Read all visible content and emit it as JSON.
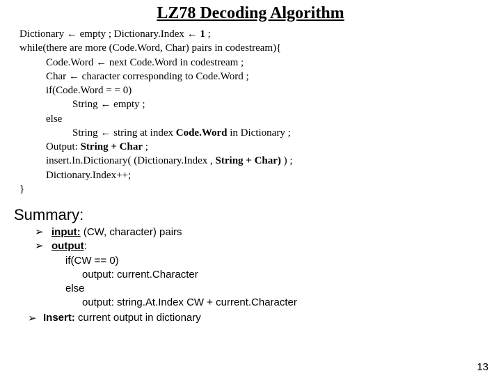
{
  "title": "LZ78 Decoding Algorithm",
  "algo": {
    "l1a": "Dictionary ← empty ; Dictionary.Index ← ",
    "l1b": "1",
    "l1c": " ;",
    "l2": "while(there are more (Code.Word, Char) pairs in codestream){",
    "l3": "Code.Word ← next Code.Word in codestream ;",
    "l4": "Char ← character corresponding to Code.Word ;",
    "l5": "if(Code.Word = = 0)",
    "l6": "String ← empty ;",
    "l7": "else",
    "l8a": "String ← string at index ",
    "l8b": "Code.Word",
    "l8c": " in Dictionary ;",
    "l9a": "Output: ",
    "l9b": "String + Char",
    "l9c": " ;",
    "l10a": "insert.In.Dictionary( (Dictionary.Index ,  ",
    "l10b": "String + Char)",
    "l10c": " ) ;",
    "l11": "Dictionary.Index++;",
    "l12": "}"
  },
  "summary": {
    "heading": "Summary:",
    "arrow": "➢",
    "items": [
      {
        "label": "input:",
        "text": " (CW, character) pairs"
      },
      {
        "label": "output",
        "text": ":",
        "sub": [
          "if(CW == 0)",
          "output: current.Character",
          "else",
          "output: string.At.Index CW + current.Character"
        ]
      },
      {
        "label": "Insert:",
        "text": " current output in dictionary"
      }
    ]
  },
  "page": "13"
}
